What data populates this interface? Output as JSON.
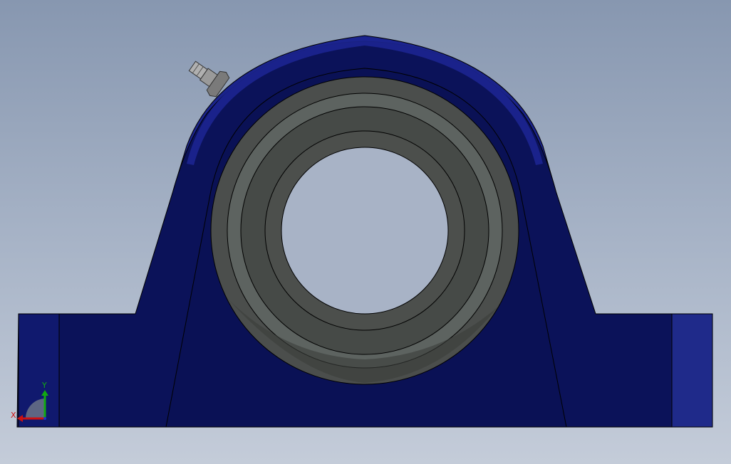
{
  "viewport": {
    "background_top": "#8797b0",
    "background_bottom": "#c4ccd9"
  },
  "model": {
    "housing_color": "#0b1259",
    "housing_edge_color": "#1c2590",
    "housing_highlight": "#1e2a9a",
    "insert_outer_color": "#4a4d4a",
    "insert_ring_color": "#5e6361",
    "bore_color": "#a8b3c6",
    "grease_fitting_color": "#9a9a9a"
  },
  "triad": {
    "x_label": "X",
    "y_label": "Y",
    "x_color": "#cc1111",
    "y_color": "#11aa11"
  }
}
